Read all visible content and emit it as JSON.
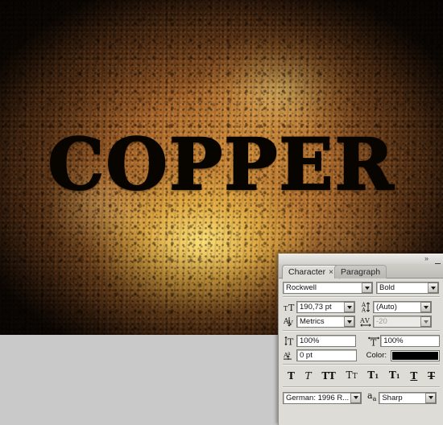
{
  "artwork": {
    "title": "COPPER"
  },
  "panel": {
    "collapse_icon": "»",
    "menu_icon": "panel-menu-icon",
    "tabs": [
      {
        "label": "Character",
        "active": true,
        "close": "×"
      },
      {
        "label": "Paragraph",
        "active": false
      }
    ],
    "font_family": {
      "value": "Rockwell",
      "icon": "font-family-icon"
    },
    "font_style": {
      "value": "Bold",
      "icon": "font-style-icon"
    },
    "font_size": {
      "value": "190,73 pt",
      "icon": "font-size-icon"
    },
    "leading": {
      "value": "(Auto)",
      "icon": "leading-icon"
    },
    "kerning": {
      "value": "Metrics",
      "icon": "kerning-icon"
    },
    "tracking": {
      "value": "-20",
      "icon": "tracking-icon",
      "disabled": true
    },
    "vertical_scale": {
      "value": "100%",
      "icon": "vertical-scale-icon"
    },
    "horizontal_scale": {
      "value": "100%",
      "icon": "horizontal-scale-icon"
    },
    "baseline_shift": {
      "value": "0 pt",
      "icon": "baseline-shift-icon"
    },
    "color": {
      "label": "Color:",
      "value": "#000000"
    },
    "style_buttons": [
      {
        "name": "faux-bold",
        "glyph": "T"
      },
      {
        "name": "faux-italic",
        "glyph": "T"
      },
      {
        "name": "all-caps",
        "glyph": "TT"
      },
      {
        "name": "small-caps",
        "glyph": "TT"
      },
      {
        "name": "superscript",
        "glyph": "T",
        "mark": "1"
      },
      {
        "name": "subscript",
        "glyph": "T",
        "mark": "1"
      },
      {
        "name": "underline",
        "glyph": "T"
      },
      {
        "name": "strikethrough",
        "glyph": "T"
      }
    ],
    "language": {
      "value": "German: 1996 R...",
      "icon": "language-icon"
    },
    "antialias": {
      "value": "Sharp",
      "icon": "anti-alias-icon"
    }
  },
  "colors": {
    "panel_bg": "#dedcd7",
    "panel_chrome": "#d6d4cf",
    "desktop_bg": "#c9c9c9",
    "text_color": "#000000"
  }
}
